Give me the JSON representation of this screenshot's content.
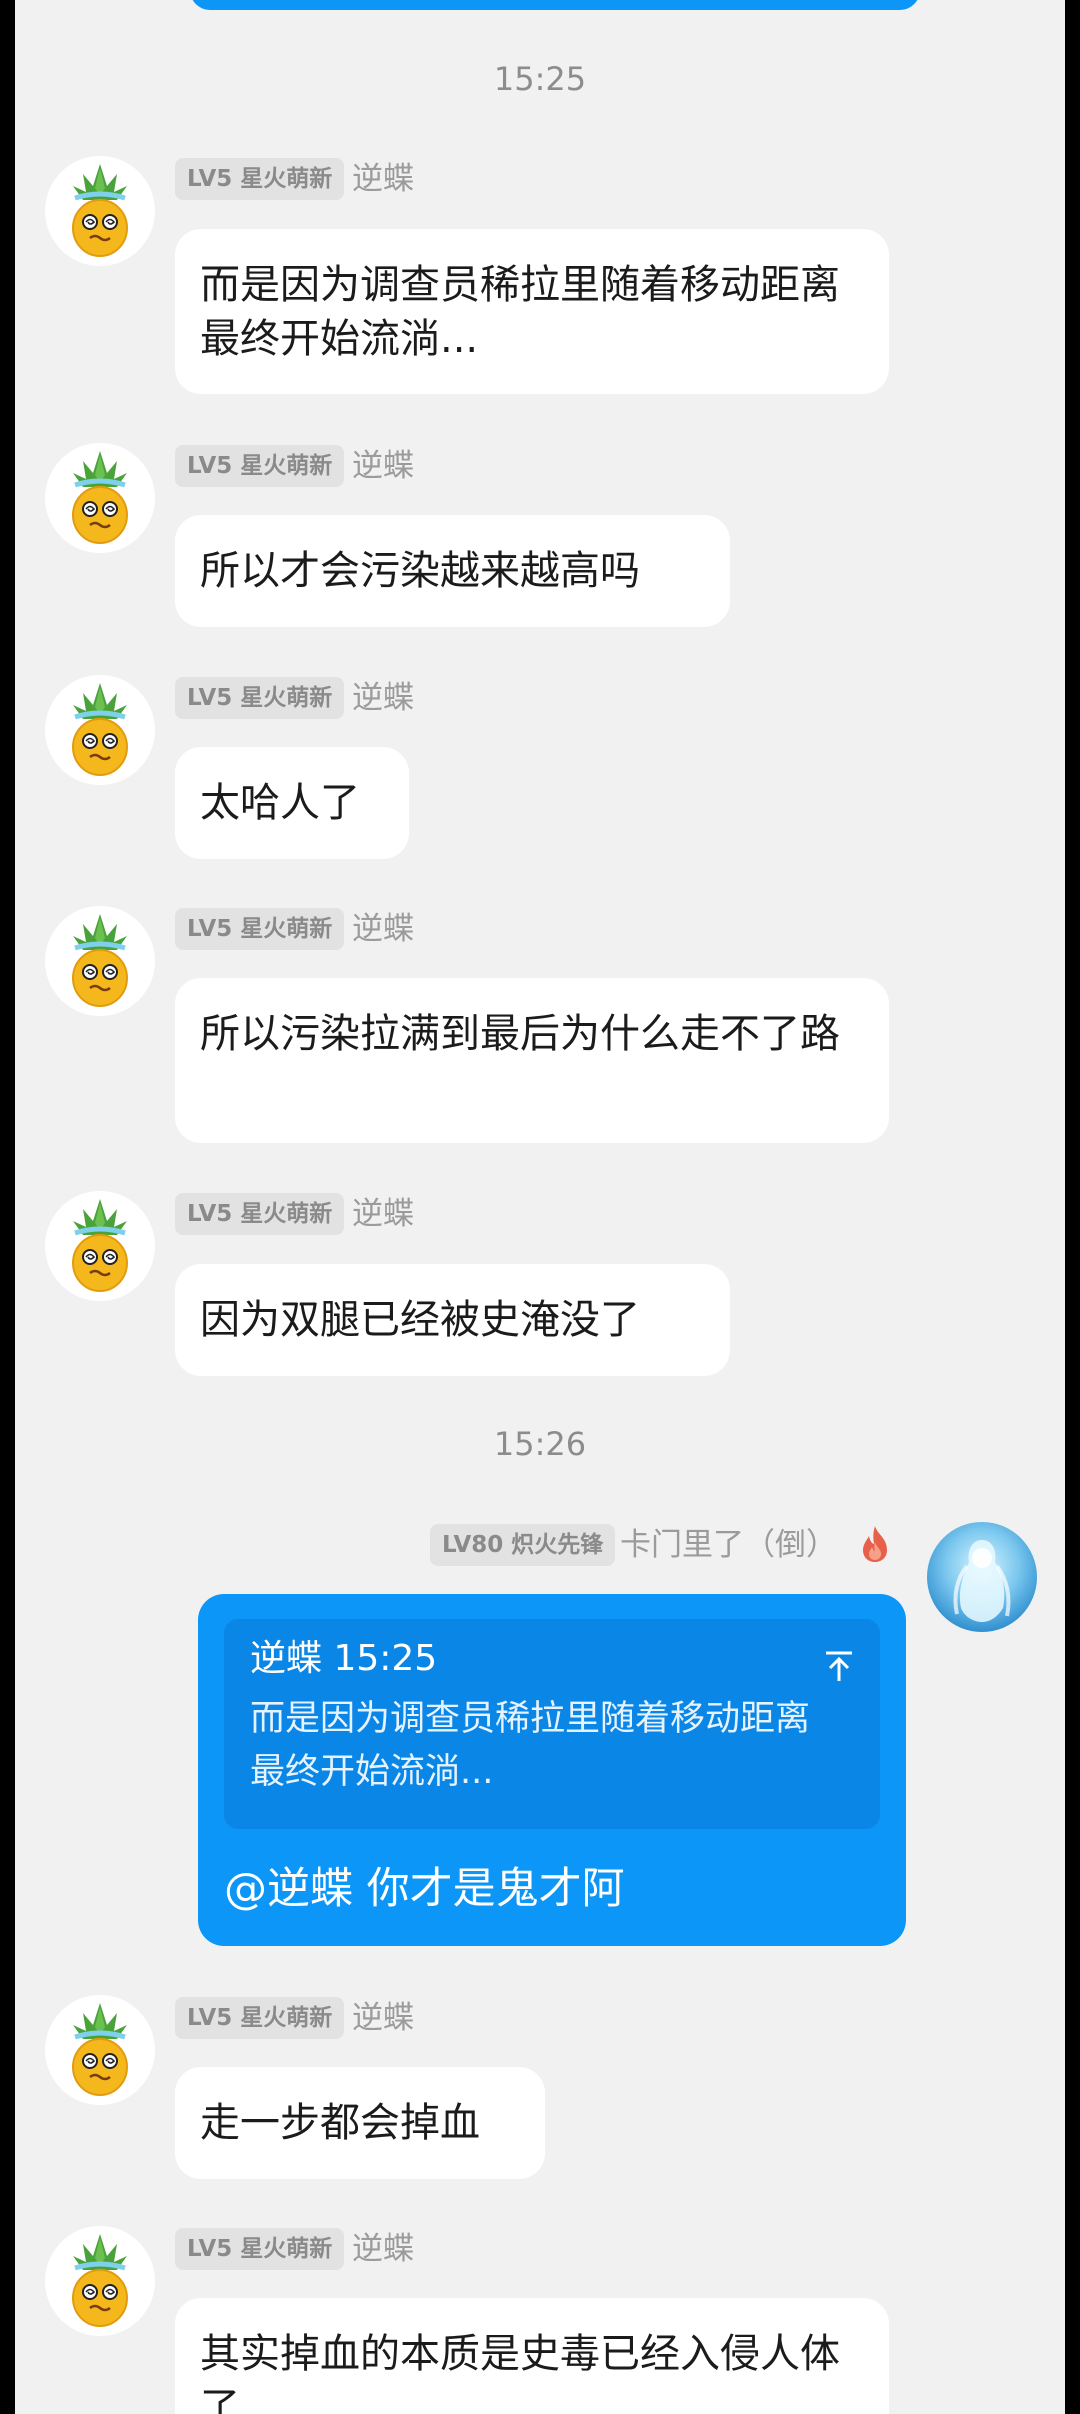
{
  "chat": {
    "top_bubble_color": "#0b96f8",
    "timestamps": [
      "15:25",
      "15:26"
    ],
    "messages": [
      {
        "level": "LV5 星火萌新",
        "sender": "逆蝶",
        "text": "而是因为调查员稀拉里随着移动距离最终开始流淌...",
        "avatar": "pineapple-avatar"
      },
      {
        "level": "LV5 星火萌新",
        "sender": "逆蝶",
        "text": "所以才会污染越来越高吗",
        "avatar": "pineapple-avatar"
      },
      {
        "level": "LV5 星火萌新",
        "sender": "逆蝶",
        "text": "太哈人了",
        "avatar": "pineapple-avatar"
      },
      {
        "level": "LV5 星火萌新",
        "sender": "逆蝶",
        "text": "所以污染拉满到最后为什么走不了路",
        "avatar": "pineapple-avatar"
      },
      {
        "level": "LV5 星火萌新",
        "sender": "逆蝶",
        "text": "因为双腿已经被史淹没了",
        "avatar": "pineapple-avatar"
      },
      {
        "level": "LV5 星火萌新",
        "sender": "逆蝶",
        "text": "走一步都会掉血",
        "avatar": "pineapple-avatar"
      },
      {
        "level": "LV5 星火萌新",
        "sender": "逆蝶",
        "text": "其实掉血的本质是史毒已经入侵人体了",
        "avatar": "pineapple-avatar"
      }
    ],
    "own_message": {
      "level": "LV80 炽火先锋",
      "sender": "卡门里了（倒）",
      "flame_icon": "flame-icon",
      "avatar": "ice-figure-avatar",
      "quote_author_time": "逆蝶 15:25",
      "quote_text": "而是因为调查员稀拉里随着移动距离最终开始流淌...",
      "reply_text": "@逆蝶 你才是鬼才阿",
      "bubble_color": "#0b96f8",
      "quote_box_color": "#0a86e6"
    }
  }
}
